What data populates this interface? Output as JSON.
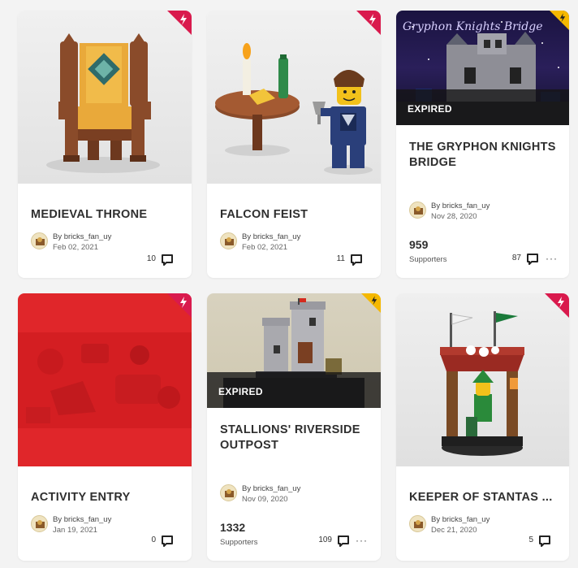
{
  "colors": {
    "product_badge": "#d91a4d",
    "expired_badge": "#f5b800",
    "activity_red": "#e0262a"
  },
  "cards": [
    {
      "title": "MEDIEVAL THRONE",
      "author": "By bricks_fan_uy",
      "date": "Feb 02, 2021",
      "comments": "10",
      "badge_icon": "lightning-icon"
    },
    {
      "title": "FALCON FEIST",
      "author": "By bricks_fan_uy",
      "date": "Feb 02, 2021",
      "comments": "11",
      "badge_icon": "lightning-icon"
    },
    {
      "title": "THE GRYPHON KNIGHTS BRIDGE",
      "image_caption": "Gryphon Knights Bridge",
      "status": "EXPIRED",
      "author": "By bricks_fan_uy",
      "date": "Nov 28, 2020",
      "supporters": "959",
      "supporters_label": "Supporters",
      "comments": "87",
      "more": "···",
      "badge_icon": "lightning-icon"
    },
    {
      "title": "ACTIVITY ENTRY",
      "author": "By bricks_fan_uy",
      "date": "Jan 19, 2021",
      "comments": "0",
      "badge_icon": "lightning-icon"
    },
    {
      "title": "STALLIONS' RIVERSIDE OUTPOST",
      "status": "EXPIRED",
      "author": "By bricks_fan_uy",
      "date": "Nov 09, 2020",
      "supporters": "1332",
      "supporters_label": "Supporters",
      "comments": "109",
      "more": "···",
      "badge_icon": "lightning-icon"
    },
    {
      "title": "KEEPER OF STANTAS ...",
      "author": "By bricks_fan_uy",
      "date": "Dec 21, 2020",
      "comments": "5",
      "badge_icon": "lightning-icon"
    }
  ]
}
